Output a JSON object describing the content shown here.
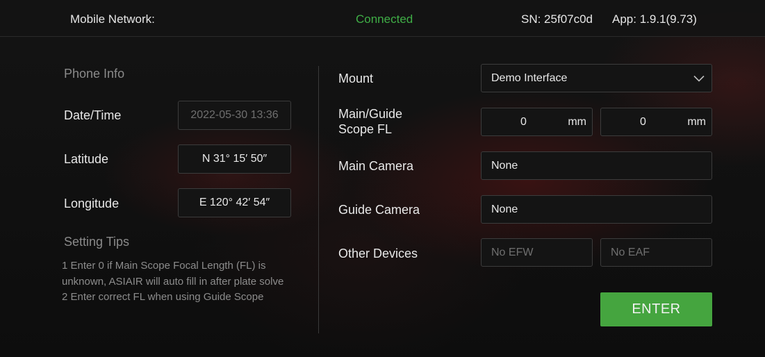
{
  "header": {
    "network_label": "Mobile Network:",
    "status": "Connected",
    "serial": "SN: 25f07c0d",
    "app_version": "App: 1.9.1(9.73)"
  },
  "phone_info": {
    "title": "Phone Info",
    "datetime_label": "Date/Time",
    "datetime_value": "2022-05-30 13:36",
    "latitude_label": "Latitude",
    "latitude_value": "N 31° 15′ 50″",
    "longitude_label": "Longitude",
    "longitude_value": "E 120° 42′ 54″"
  },
  "tips": {
    "title": "Setting Tips",
    "line1": "1 Enter 0 if Main Scope Focal Length (FL) is unknown, ASIAIR will auto fill in after plate solve",
    "line2": "2 Enter correct FL when using Guide Scope"
  },
  "devices": {
    "mount_label": "Mount",
    "mount_value": "Demo Interface",
    "scope_fl_label_line1": "Main/Guide",
    "scope_fl_label_line2": "Scope FL",
    "main_fl_value": "0",
    "main_fl_unit": "mm",
    "guide_fl_value": "0",
    "guide_fl_unit": "mm",
    "main_camera_label": "Main Camera",
    "main_camera_value": "None",
    "guide_camera_label": "Guide Camera",
    "guide_camera_value": "None",
    "other_devices_label": "Other Devices",
    "efw_value": "No EFW",
    "eaf_value": "No EAF"
  },
  "actions": {
    "enter_label": "ENTER"
  },
  "colors": {
    "status_green": "#3fae46",
    "button_green": "#45a53f"
  }
}
